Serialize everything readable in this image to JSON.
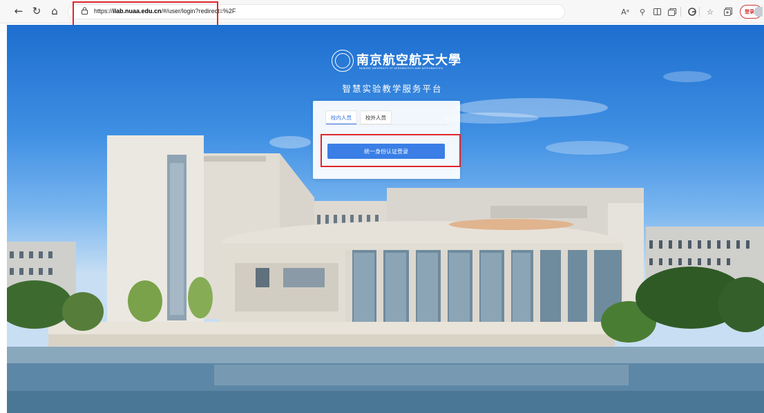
{
  "browser": {
    "url_prefix": "https://",
    "url_host": "ilab.nuaa.edu.cn",
    "url_path": "/#/user/login?redirect=%2F",
    "nav_icons": {
      "back": "arrow-left-icon",
      "refresh": "refresh-icon",
      "home": "home-icon"
    },
    "right_icons": [
      "read-aloud-icon",
      "zoom-icon",
      "split-screen-icon",
      "tab-actions-icon",
      "extension-icon",
      "favorites-icon",
      "collections-icon"
    ],
    "read_aloud_glyph": "Aᵃ",
    "profile_label": "登录"
  },
  "page": {
    "brand_name": "南京航空航天大學",
    "brand_en": "NANJING UNIVERSITY OF AERONAUTICS AND ASTRONAUTICS",
    "platform_title": "智慧实验教学服务平台",
    "tabs": [
      {
        "label": "校内人员",
        "active": true
      },
      {
        "label": "校外人员",
        "active": false
      }
    ],
    "sso_button": "统一身份认证登录"
  },
  "colors": {
    "accent": "#3a7ee6",
    "highlight": "#e0262c"
  }
}
